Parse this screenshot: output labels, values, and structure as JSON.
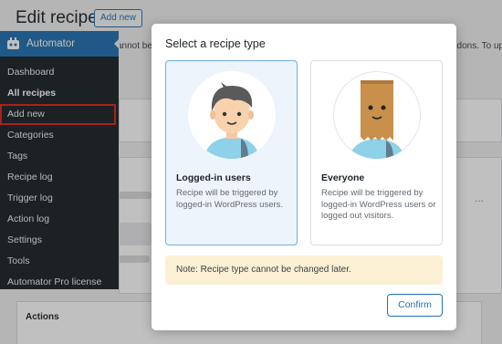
{
  "page": {
    "title": "Edit recipe",
    "add_new_label": "Add new",
    "notice_left": "annot be",
    "notice_right": "ddons. To up",
    "actions_title": "Actions",
    "ellipsis": "..."
  },
  "sidebar": {
    "brand": "Automator",
    "items": [
      {
        "label": "Dashboard"
      },
      {
        "label": "All recipes"
      },
      {
        "label": "Add new"
      },
      {
        "label": "Categories"
      },
      {
        "label": "Tags"
      },
      {
        "label": "Recipe log"
      },
      {
        "label": "Trigger log"
      },
      {
        "label": "Action log"
      },
      {
        "label": "Settings"
      },
      {
        "label": "Tools"
      },
      {
        "label": "Automator Pro license"
      }
    ],
    "active_item": "All recipes",
    "highlighted_item": "Add new"
  },
  "modal": {
    "title": "Select a recipe type",
    "cards": [
      {
        "title": "Logged-in users",
        "description": "Recipe will be triggered by logged-in WordPress users.",
        "icon": "user-avatar-icon",
        "selected": true
      },
      {
        "title": "Everyone",
        "description": "Recipe will be triggered by logged-in WordPress users or logged out visitors.",
        "icon": "paper-bag-head-icon",
        "selected": false
      }
    ],
    "note": "Note: Recipe type cannot be changed later.",
    "confirm_label": "Confirm"
  },
  "colors": {
    "accent": "#2271b1",
    "sidebar_bg": "#1d2327",
    "highlight_outline": "#e0251c",
    "note_bg": "#fcf0d4",
    "selected_card_bg": "#edf4fb"
  }
}
